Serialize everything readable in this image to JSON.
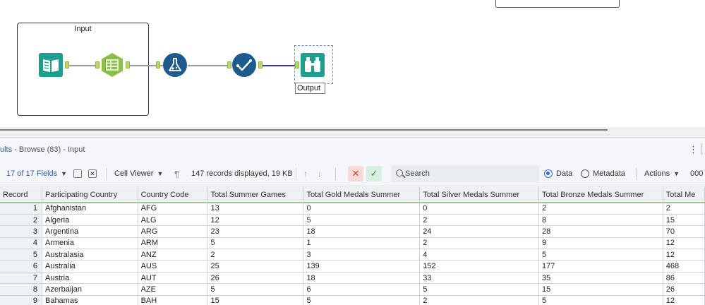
{
  "canvas": {
    "container_title": "Input",
    "output_label": "Output"
  },
  "results": {
    "title_prefix": "ults",
    "title_rest": " - Browse (83) - Input"
  },
  "toolbar": {
    "fields": "17 of 17 Fields",
    "cell_viewer": "Cell Viewer",
    "records_info": "147 records displayed, 19 KB",
    "search_placeholder": "Search",
    "radio_data": "Data",
    "radio_metadata": "Metadata",
    "actions": "Actions",
    "extra": "000"
  },
  "table": {
    "columns": [
      "Record",
      "Participating Country",
      "Country Code",
      "Total Summer Games",
      "Total Gold Medals Summer",
      "Total Silver Medals Summer",
      "Total Bronze Medals Summer",
      "Total Me"
    ],
    "rows": [
      [
        "1",
        "Afghanistan",
        "AFG",
        "13",
        "0",
        "0",
        "2",
        "2"
      ],
      [
        "2",
        "Algeria",
        "ALG",
        "12",
        "5",
        "2",
        "8",
        "15"
      ],
      [
        "3",
        "Argentina",
        "ARG",
        "23",
        "18",
        "24",
        "28",
        "70"
      ],
      [
        "4",
        "Armenia",
        "ARM",
        "5",
        "1",
        "2",
        "9",
        "12"
      ],
      [
        "5",
        "Australasia",
        "ANZ",
        "2",
        "3",
        "4",
        "5",
        "12"
      ],
      [
        "6",
        "Australia",
        "AUS",
        "25",
        "139",
        "152",
        "177",
        "468"
      ],
      [
        "7",
        "Austria",
        "AUT",
        "26",
        "18",
        "33",
        "35",
        "86"
      ],
      [
        "8",
        "Azerbaijan",
        "AZE",
        "5",
        "6",
        "5",
        "15",
        "26"
      ],
      [
        "9",
        "Bahamas",
        "BAH",
        "15",
        "5",
        "2",
        "5",
        "12"
      ]
    ]
  },
  "colors": {
    "accent": "#2e5fa8",
    "teal_tool": "#1f9d8f",
    "green_tool": "#8cbf4a",
    "blue_tool": "#1f5a8c",
    "header_underline": "#9bd07c"
  }
}
